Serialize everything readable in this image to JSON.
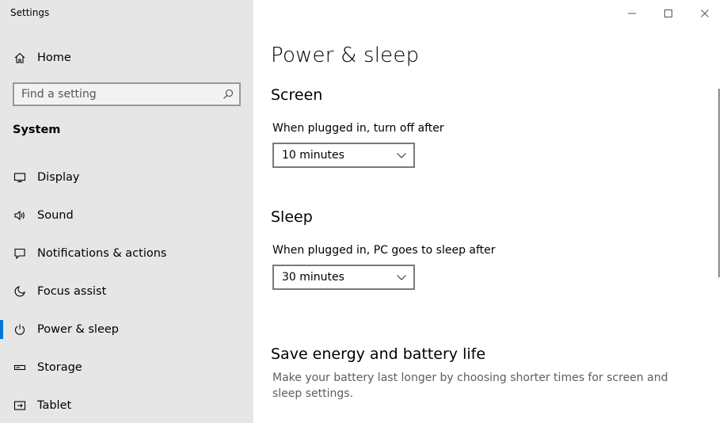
{
  "window": {
    "title": "Settings",
    "controls": {
      "minimize": "—",
      "maximize": "☐",
      "close": "✕"
    }
  },
  "sidebar": {
    "home_label": "Home",
    "search": {
      "placeholder": "Find a setting",
      "value": ""
    },
    "section_label": "System",
    "items": [
      {
        "label": "Display",
        "icon": "monitor-icon"
      },
      {
        "label": "Sound",
        "icon": "speaker-icon"
      },
      {
        "label": "Notifications & actions",
        "icon": "message-icon"
      },
      {
        "label": "Focus assist",
        "icon": "moon-icon"
      },
      {
        "label": "Power & sleep",
        "icon": "power-icon",
        "selected": true
      },
      {
        "label": "Storage",
        "icon": "storage-icon"
      },
      {
        "label": "Tablet",
        "icon": "tablet-icon"
      }
    ]
  },
  "main": {
    "page_title": "Power & sleep",
    "screen": {
      "heading": "Screen",
      "label": "When plugged in, turn off after",
      "value": "10 minutes"
    },
    "sleep": {
      "heading": "Sleep",
      "label": "When plugged in, PC goes to sleep after",
      "value": "30 minutes"
    },
    "save_energy": {
      "heading": "Save energy and battery life",
      "description": "Make your battery last longer by choosing shorter times for screen and sleep settings."
    }
  },
  "colors": {
    "accent": "#0078d7",
    "sidebar_bg": "#e6e6e6",
    "main_bg": "#ffffff"
  }
}
